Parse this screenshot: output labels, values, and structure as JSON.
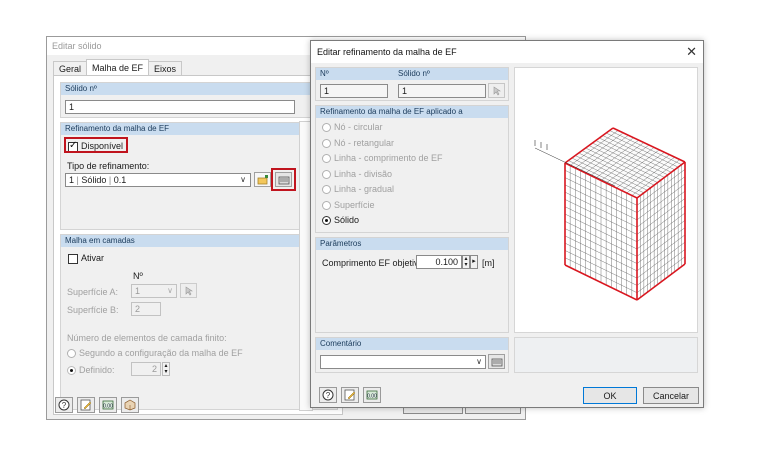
{
  "back_dialog": {
    "title": "Editar sólido",
    "tabs": [
      "Geral",
      "Malha de EF",
      "Eixos"
    ],
    "solid_no": {
      "header": "Sólido nº",
      "value": "1"
    },
    "refinement": {
      "header": "Refinamento da malha de EF",
      "available_label": "Disponível",
      "available_checked": true,
      "type_label": "Tipo de refinamento:",
      "type_no": "1",
      "type_kind": "Sólido",
      "type_value": "0.1"
    },
    "layered": {
      "header": "Malha em camadas",
      "activate_label": "Ativar",
      "no_header": "Nº",
      "surface_a_label": "Superfície A:",
      "surface_a_value": "1",
      "surface_b_label": "Superfície B:",
      "surface_b_value": "2",
      "finite_layers_label": "Número de elementos de camada finito:",
      "option_config": "Segundo a configuração da malha de EF",
      "option_defined": "Definido:",
      "defined_value": "2"
    }
  },
  "front_dialog": {
    "title": "Editar refinamento da malha de EF",
    "no_header": "Nº",
    "no_value": "1",
    "solid_header": "Sólido nº",
    "solid_value": "1",
    "applied_header": "Refinamento da malha de EF aplicado a",
    "applied_options": [
      "Nó - circular",
      "Nó - retangular",
      "Linha - comprimento de EF",
      "Linha - divisão",
      "Linha - gradual",
      "Superfície",
      "Sólido"
    ],
    "applied_selected": "Sólido",
    "params_header": "Parâmetros",
    "target_length_label": "Comprimento EF objetivo:",
    "target_length_value": "0.100",
    "target_length_unit": "[m]",
    "comment_header": "Comentário",
    "comment_value": "",
    "ok_label": "OK",
    "cancel_label": "Cancelar"
  },
  "colors": {
    "group_header": "#c9dcef",
    "highlight_red": "#c0141e",
    "mesh_red": "#d9161f",
    "dialog_bg": "#f0f0f0"
  },
  "icons": {
    "help": "help-icon",
    "edit": "edit-icon",
    "units": "units-icon",
    "model": "model-icon",
    "select": "pick-icon",
    "new": "new-icon",
    "edit_item": "edit-item-icon"
  }
}
